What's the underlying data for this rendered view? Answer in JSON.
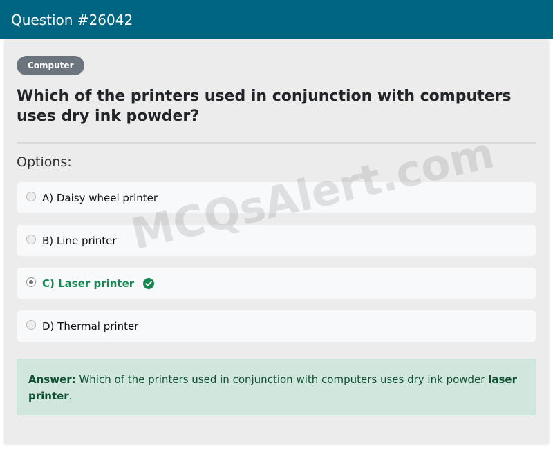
{
  "header": {
    "title": "Question #26042"
  },
  "category": {
    "label": "Computer"
  },
  "question": {
    "text": "Which of the printers used in conjunction with computers uses dry ink powder?"
  },
  "options_title": "Options:",
  "options": [
    {
      "label": "A) Daisy wheel printer",
      "selected": false,
      "correct": false
    },
    {
      "label": "B) Line printer",
      "selected": false,
      "correct": false
    },
    {
      "label": "C) Laser printer",
      "selected": true,
      "correct": true
    },
    {
      "label": "D) Thermal printer",
      "selected": false,
      "correct": false
    }
  ],
  "answer": {
    "prefix": "Answer:",
    "text": "Which of the printers used in conjunction with computers uses dry ink powder",
    "highlight": "laser printer",
    "suffix": "."
  },
  "watermark": {
    "text": "MCQsAlert.com"
  },
  "colors": {
    "header_bg": "#006580",
    "badge_bg": "#6c757d",
    "correct_green": "#198754",
    "answer_bg": "#d1e7dd"
  },
  "icons": {
    "correct_mark": "check-circle-icon"
  }
}
